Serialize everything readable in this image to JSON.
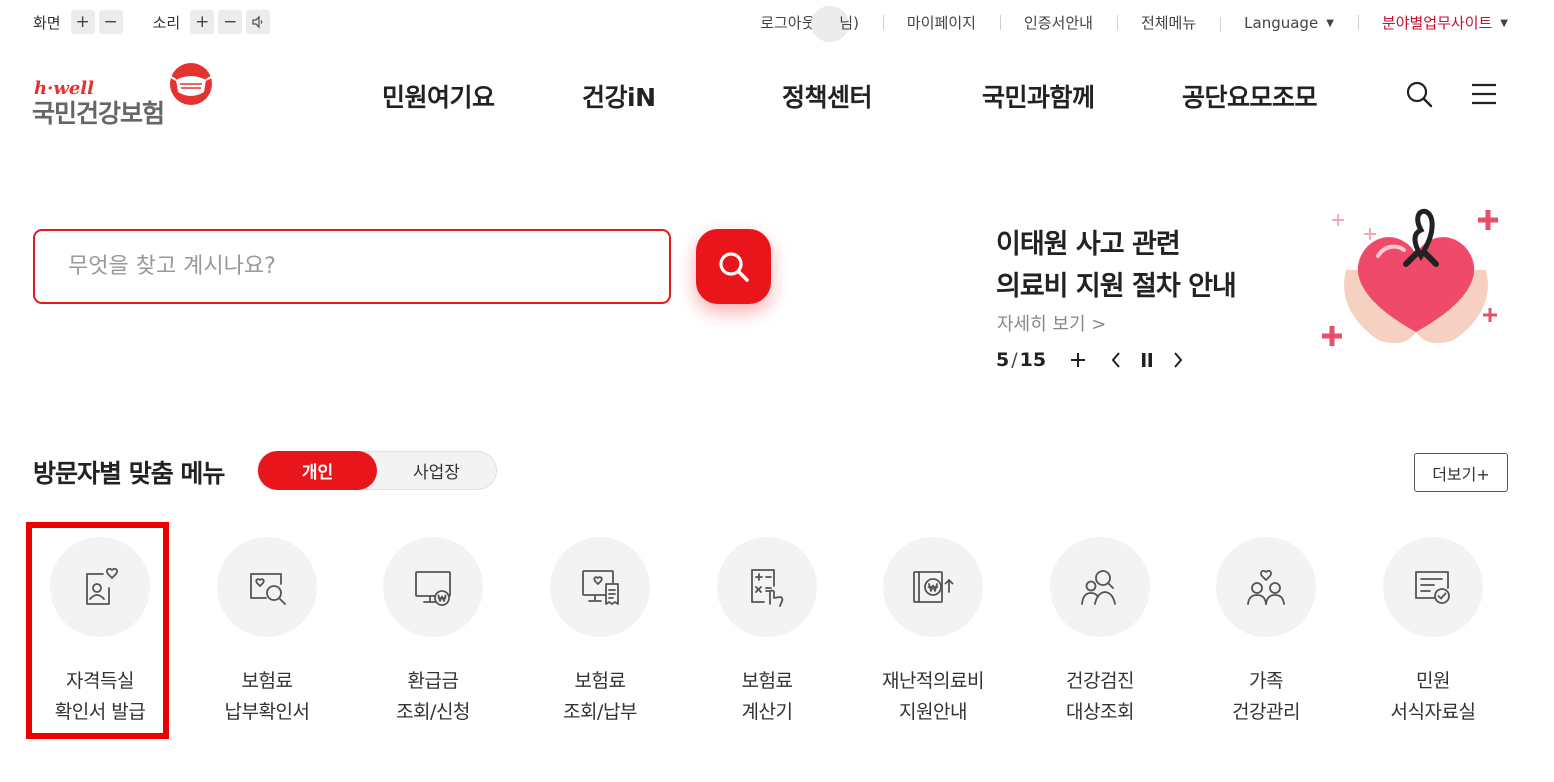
{
  "utility": {
    "screen_label": "화면",
    "sound_label": "소리",
    "plus": "+",
    "minus": "−",
    "logout_prefix": "로그아웃(",
    "logout_suffix": "님)",
    "mypage": "마이페이지",
    "certificate_guide": "인증서안내",
    "all_menu": "전체메뉴",
    "language": "Language",
    "field_site": "분야별업무사이트"
  },
  "logo": {
    "brand_en": "h·well",
    "brand_ko": "국민건강보험"
  },
  "gnb": [
    "민원여기요",
    "건강iN",
    "정책센터",
    "국민과함께",
    "공단요모조모"
  ],
  "search": {
    "placeholder": "무엇을 찾고 계시나요?"
  },
  "banner": {
    "title_line1": "이태원 사고 관련",
    "title_line2": "의료비 지원 절차 안내",
    "more": "자세히 보기 >",
    "current": "5",
    "separator": "/",
    "total": "15",
    "plus": "+"
  },
  "custom_menu": {
    "title": "방문자별 맞춤 메뉴",
    "tab_personal": "개인",
    "tab_business": "사업장",
    "more": "더보기+",
    "items": [
      {
        "line1": "자격득실",
        "line2": "확인서 발급",
        "icon": "id-card-heart-icon"
      },
      {
        "line1": "보험료",
        "line2": "납부확인서",
        "icon": "document-search-icon"
      },
      {
        "line1": "환급금",
        "line2": "조회/신청",
        "icon": "monitor-won-icon"
      },
      {
        "line1": "보험료",
        "line2": "조회/납부",
        "icon": "monitor-receipt-icon"
      },
      {
        "line1": "보험료",
        "line2": "계산기",
        "icon": "calculator-icon"
      },
      {
        "line1": "재난적의료비",
        "line2": "지원안내",
        "icon": "book-won-icon"
      },
      {
        "line1": "건강검진",
        "line2": "대상조회",
        "icon": "people-search-icon"
      },
      {
        "line1": "가족",
        "line2": "건강관리",
        "icon": "family-heart-icon"
      },
      {
        "line1": "민원",
        "line2": "서식자료실",
        "icon": "form-check-icon"
      }
    ]
  },
  "colors": {
    "brand_red": "#e8161a",
    "highlight": "#ee0000",
    "icon_stroke": "#555555"
  }
}
